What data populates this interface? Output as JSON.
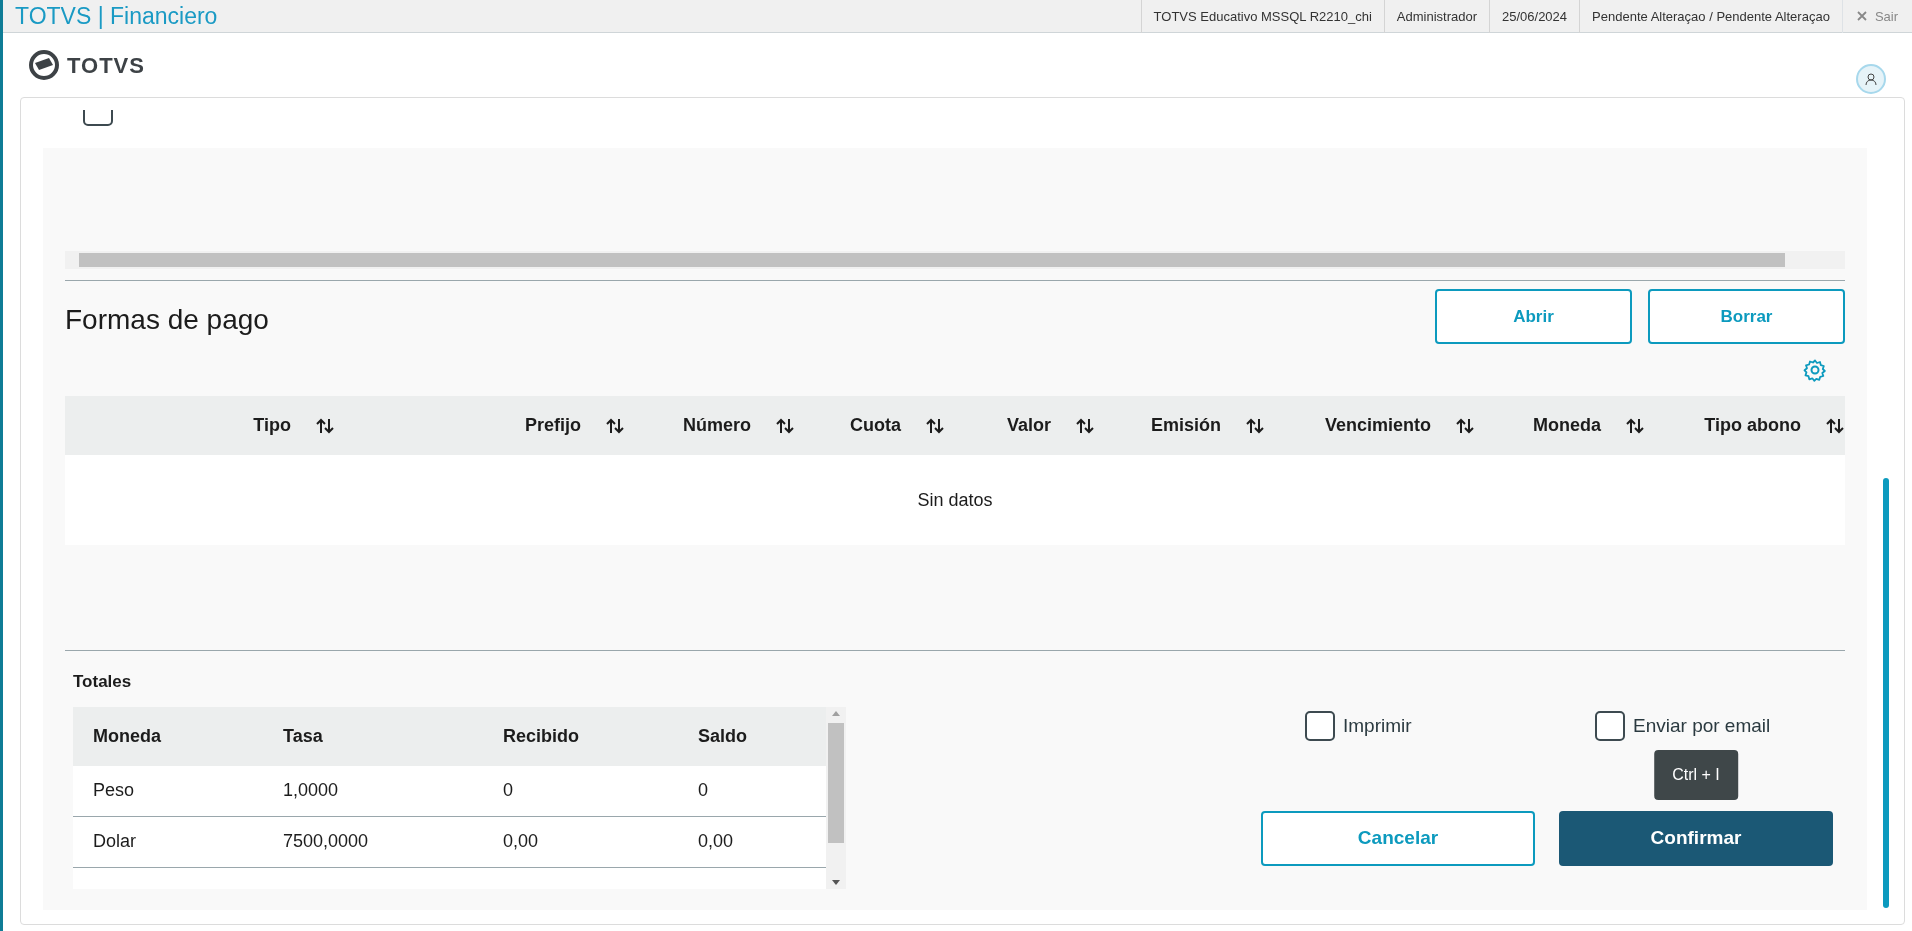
{
  "header": {
    "title": "TOTVS | Financiero",
    "info": [
      "TOTVS Educativo MSSQL R2210_chi",
      "Administrador",
      "25/06/2024",
      "Pendente Alteraçao / Pendente Alteraçao"
    ],
    "logout": "Sair"
  },
  "logo": {
    "text": "TOTVS"
  },
  "document_row": {
    "checked": false
  },
  "payment_section": {
    "title": "Formas de pago",
    "buttons": [
      "Abrir",
      "Borrar"
    ],
    "columns": [
      "Tipo",
      "Prefijo",
      "Número",
      "Cuota",
      "Valor",
      "Emisión",
      "Vencimiento",
      "Moneda",
      "Tipo abono"
    ],
    "empty_text": "Sin datos"
  },
  "totals": {
    "title": "Totales",
    "columns": [
      "Moneda",
      "Tasa",
      "Recibido",
      "Saldo"
    ],
    "rows": [
      [
        "Peso",
        "1,0000",
        "0",
        "0"
      ],
      [
        "Dolar",
        "7500,0000",
        "0,00",
        "0,00"
      ]
    ]
  },
  "options": [
    {
      "label": "Imprimir",
      "checked": false
    },
    {
      "label": "Enviar por email",
      "checked": false
    }
  ],
  "tooltip": "Ctrl + I",
  "actions": [
    {
      "label": "Cancelar",
      "kind": "secondary"
    },
    {
      "label": "Confirmar",
      "kind": "primary"
    }
  ]
}
